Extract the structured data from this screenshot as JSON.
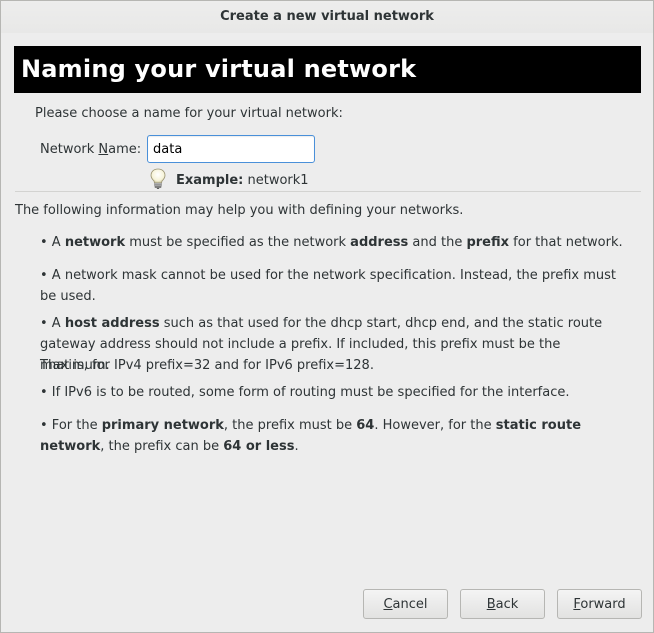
{
  "window": {
    "title": "Create a new virtual network"
  },
  "header": {
    "title": "Naming your virtual network"
  },
  "form": {
    "prompt": "Please choose a name for your virtual network:",
    "name_label_pre": "Network ",
    "name_label_mnemonic": "N",
    "name_label_post": "ame:",
    "name_value": "data",
    "example_label": "Example:",
    "example_value": "network1"
  },
  "info": {
    "intro": "The following information may help you with defining your networks.",
    "bullets": [
      {
        "parts": [
          "• A ",
          "network",
          " must be specified as the network ",
          "address",
          " and the ",
          "prefix",
          " for that network."
        ]
      },
      {
        "line1": "• A network mask cannot be used for the network specification.  Instead, the prefix must",
        "line2": "be used."
      },
      {
        "pre": "• A ",
        "bold": "host address",
        "post": " such as that used for the dhcp start, dhcp end, and the static route",
        "line2": "gateway address should not include a prefix.  If included, this prefix must be the maximum.",
        "line3": "That is, for IPv4 prefix=32 and for IPv6 prefix=128."
      },
      {
        "line1": "• If IPv6 is to be routed, some form of routing must be specified for the interface."
      },
      {
        "a": "• For the ",
        "b": "primary network",
        "c": ", the prefix must be ",
        "d": "64",
        "e": ".  However, for the ",
        "f": "static route",
        "g": "network",
        "h": ", the prefix can be ",
        "i": "64 or less",
        "j": "."
      }
    ]
  },
  "buttons": {
    "cancel_mnemonic": "C",
    "cancel_rest": "ancel",
    "back_mnemonic": "B",
    "back_rest": "ack",
    "forward_mnemonic": "F",
    "forward_rest": "orward"
  }
}
